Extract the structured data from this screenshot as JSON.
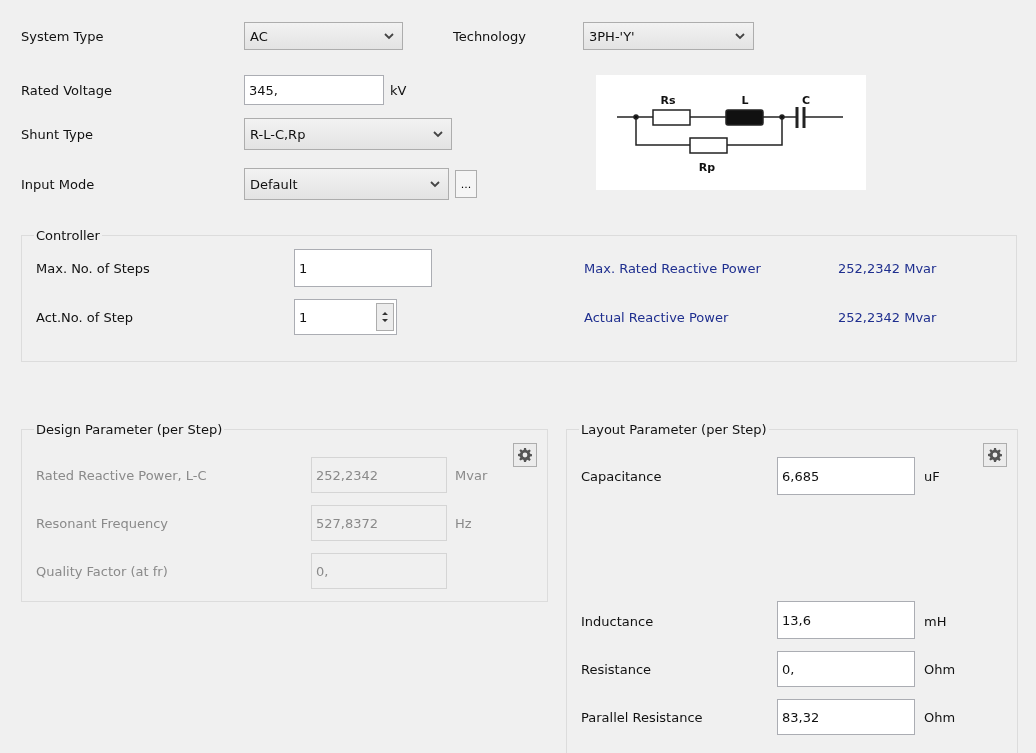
{
  "top_form": {
    "system_type": {
      "label": "System Type",
      "value": "AC"
    },
    "technology": {
      "label": "Technology",
      "value": "3PH-'Y'"
    },
    "rated_voltage": {
      "label": "Rated Voltage",
      "value": "345,",
      "unit": "kV"
    },
    "shunt_type": {
      "label": "Shunt Type",
      "value": "R-L-C,Rp"
    },
    "input_mode": {
      "label": "Input Mode",
      "value": "Default",
      "button": "..."
    }
  },
  "circuit_diagram": {
    "labels": [
      "Rs",
      "L",
      "C",
      "Rp"
    ]
  },
  "controller": {
    "title": "Controller",
    "rows": [
      {
        "kind": "text",
        "label": "Max. No. of Steps",
        "value": "1"
      },
      {
        "kind": "spinner",
        "label": "Act.No. of Step",
        "value": "1"
      }
    ],
    "readouts": [
      {
        "label": "Max. Rated Reactive Power",
        "value": "252,2342 Mvar"
      },
      {
        "label": "Actual Reactive Power",
        "value": "252,2342 Mvar"
      }
    ]
  },
  "design_parameter": {
    "title": "Design Parameter (per Step)",
    "rows": [
      {
        "label": "Rated Reactive Power, L-C",
        "value": "252,2342",
        "unit": "Mvar",
        "disabled": true
      },
      {
        "label": "Resonant Frequency",
        "value": "527,8372",
        "unit": "Hz",
        "disabled": true
      },
      {
        "label": "Quality Factor (at fr)",
        "value": "0,",
        "disabled": true
      }
    ]
  },
  "layout_parameter": {
    "title": "Layout Parameter (per Step)",
    "rows": [
      {
        "label": "Capacitance",
        "value": "6,685",
        "unit": "uF",
        "disabled": false
      },
      {
        "label": "Inductance",
        "value": "13,6",
        "unit": "mH",
        "disabled": false
      },
      {
        "label": "Resistance",
        "value": "0,",
        "unit": "Ohm",
        "disabled": false
      },
      {
        "label": "Parallel Resistance",
        "value": "83,32",
        "unit": "Ohm",
        "disabled": false
      }
    ]
  }
}
